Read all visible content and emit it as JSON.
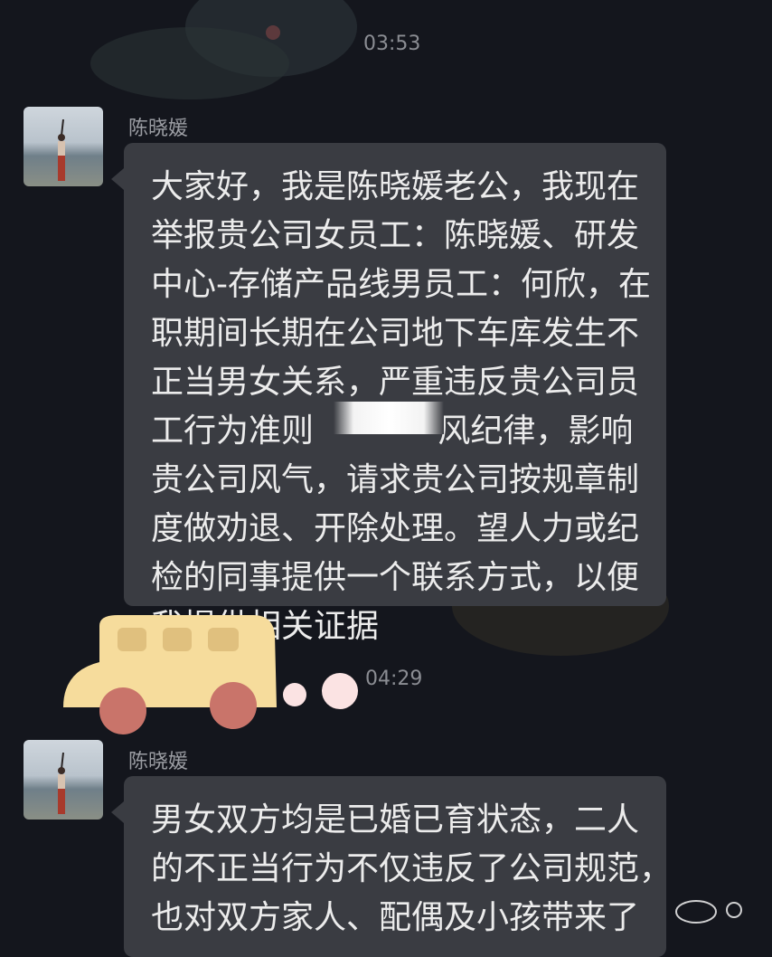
{
  "messages": [
    {
      "time": "03:53",
      "sender": "陈晓媛",
      "lines": [
        "大家好，我是陈晓媛老公，我现在",
        "举报贵公司女员工：陈晓媛、研发",
        "中心-存储产品线男员工：何欣，在",
        "职期间长期在公司地下车库发生不",
        "正当男女关系，严重违反贵公司员",
        "工行为准则            风纪律，影响",
        "贵公司风气，请求贵公司按规章制",
        "度做劝退、开除处理。望人力或纪",
        "检的同事提供一个联系方式，以便",
        "我提供相关证据"
      ]
    },
    {
      "time": "04:29",
      "sender": "陈晓媛",
      "lines": [
        "男女双方均是已婚已育状态，二人",
        "的不正当行为不仅违反了公司规范，",
        "也对双方家人、配偶及小孩带来了"
      ]
    }
  ],
  "colors": {
    "background": "#14161d",
    "bubble": "#3a3c42",
    "text": "#ececec",
    "timestamp": "#8b8d93",
    "bus_body": "#f6dc9c",
    "bus_wheel": "#c9746a",
    "bubble_dots": "#fbe3e3"
  },
  "icons": [
    "avatar-photo",
    "bus-sticker",
    "watermark-logo"
  ]
}
